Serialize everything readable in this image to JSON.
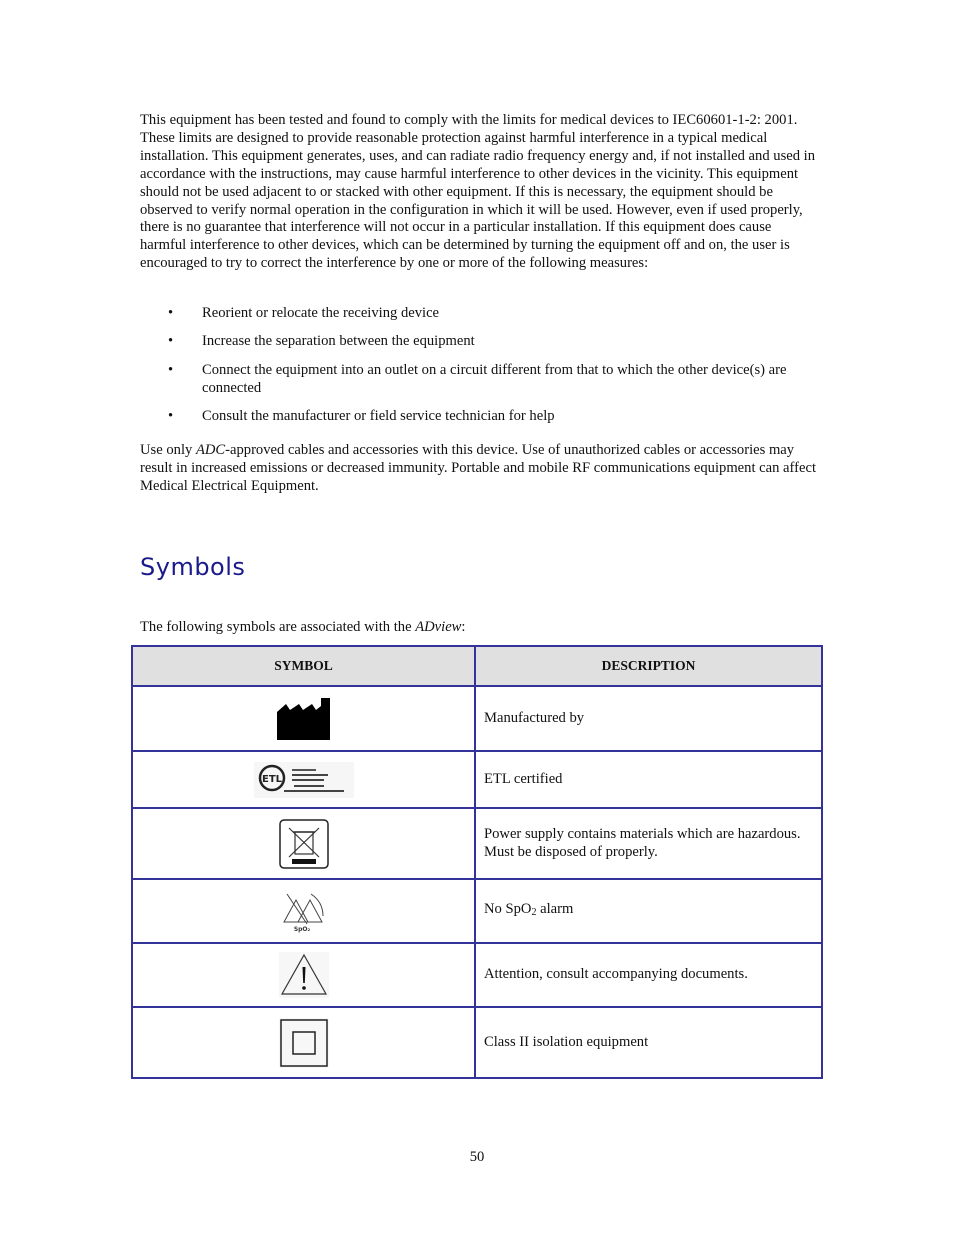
{
  "body": {
    "paragraph1": "This equipment has been tested and found to comply with the limits for medical devices to IEC60601-1-2: 2001. These limits are designed to provide reasonable protection against harmful interference in a typical medical installation. This equipment generates, uses, and can radiate radio frequency energy and, if not installed and used in accordance with the instructions, may cause harmful interference to other devices in the vicinity. This equipment should not be used adjacent to or stacked with other equipment. If this is necessary, the equipment should be observed to verify normal operation in the configuration in which it will be used. However, even if used properly, there is no guarantee that interference will not occur in a particular installation. If this equipment does cause harmful interference to other devices, which can be determined by turning the equipment off and on, the user is encouraged to try to correct the interference by one or more of the following measures:",
    "bullet_glyph": "•",
    "bullets": [
      "Reorient or relocate the receiving device",
      "Increase the separation between the equipment",
      "Connect the equipment into an outlet on a circuit different from that to which the other device(s) are connected",
      "Consult the manufacturer or field service technician for help"
    ],
    "paragraph2_prefix": "Use only ",
    "paragraph2_brand": "ADC",
    "paragraph2_rest": "-approved cables and accessories with this device. Use of unauthorized cables or accessories may result in increased emissions or decreased immunity. Portable and mobile RF communications equipment can affect Medical Electrical Equipment."
  },
  "section": {
    "heading": "Symbols",
    "intro_prefix": "The following symbols are associated with the ",
    "intro_product": "ADview",
    "intro_suffix": ":"
  },
  "table": {
    "headers": {
      "symbol": "SYMBOL",
      "description": "DESCRIPTION"
    },
    "rows": [
      {
        "icon": "manufacturer-icon",
        "description": "Manufactured by"
      },
      {
        "icon": "etl-certified-mark-icon",
        "description": "ETL certified"
      },
      {
        "icon": "weee-crossed-bin-icon",
        "description": "Power supply contains materials which are hazardous.  Must be disposed of properly."
      },
      {
        "icon": "no-spo2-alarm-icon",
        "description_prefix": "No SpO",
        "description_sub": "2",
        "description_suffix": " alarm"
      },
      {
        "icon": "caution-triangle-icon",
        "description": "Attention, consult accompanying documents."
      },
      {
        "icon": "class-ii-double-square-icon",
        "description": "Class II isolation equipment"
      }
    ],
    "spo2_label": "SpO₂"
  },
  "colors": {
    "heading": "#1a1a8c",
    "table_border": "#33339a",
    "header_bg": "#e0e0e0"
  },
  "footer": {
    "page_number": "50"
  }
}
